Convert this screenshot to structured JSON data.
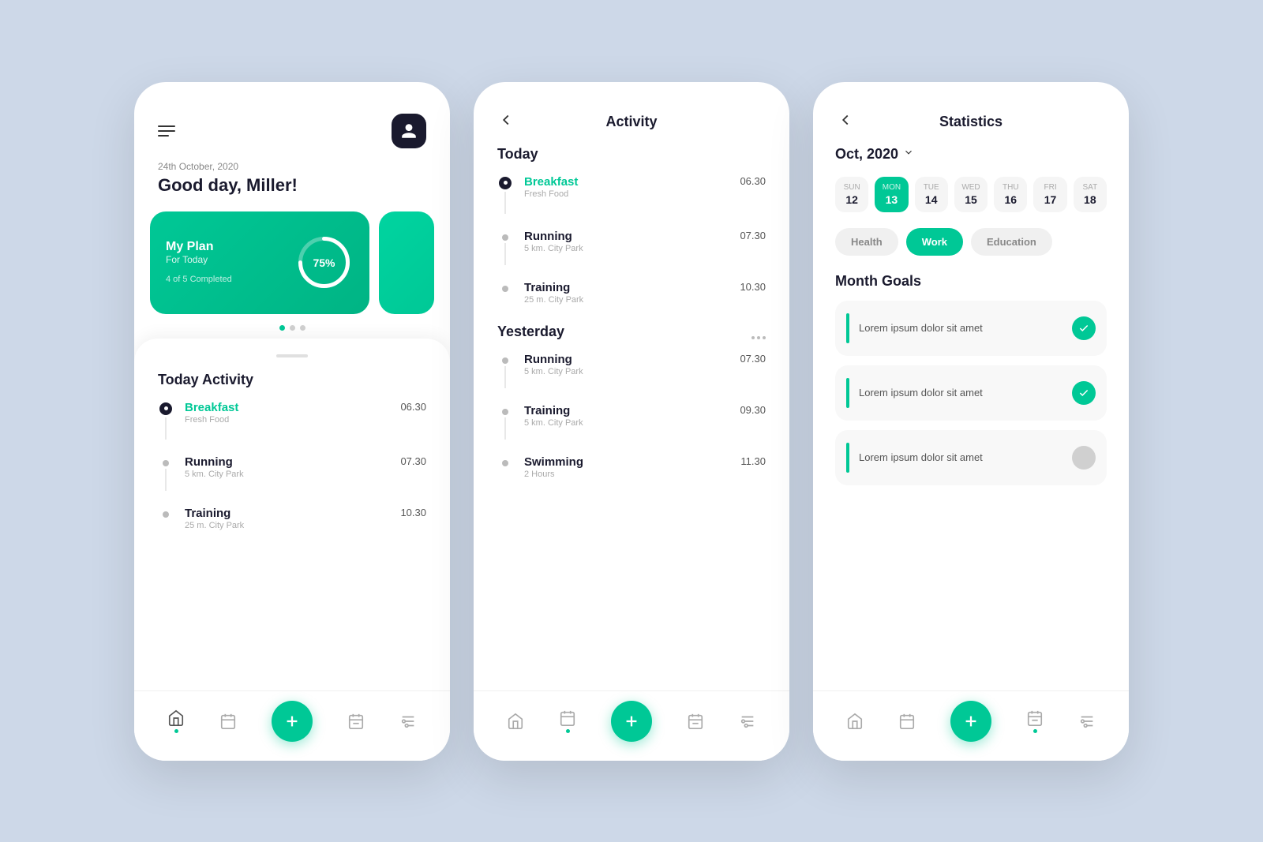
{
  "phone1": {
    "date": "24th October, 2020",
    "greeting": "Good day, Miller!",
    "plan": {
      "title": "My Plan",
      "subtitle": "For Today",
      "completed": "4 of 5 Completed",
      "progress": "75%"
    },
    "today_activity_title": "Today Activity",
    "activities": [
      {
        "name": "Breakfast",
        "sub": "Fresh Food",
        "time": "06.30",
        "done": true,
        "teal": true
      },
      {
        "name": "Running",
        "sub": "5 km. City Park",
        "time": "07.30",
        "done": false,
        "teal": false
      },
      {
        "name": "Training",
        "sub": "25 m. City Park",
        "time": "10.30",
        "done": false,
        "teal": false
      }
    ]
  },
  "phone2": {
    "back_label": "←",
    "title": "Activity",
    "today_label": "Today",
    "today_activities": [
      {
        "name": "Breakfast",
        "sub": "Fresh Food",
        "time": "06.30",
        "done": true,
        "teal": true
      },
      {
        "name": "Running",
        "sub": "5 km. City Park",
        "time": "07.30",
        "done": false,
        "teal": false
      },
      {
        "name": "Training",
        "sub": "25 m. City Park",
        "time": "10.30",
        "done": false,
        "teal": false
      }
    ],
    "yesterday_label": "Yesterday",
    "yesterday_activities": [
      {
        "name": "Running",
        "sub": "5 km. City Park",
        "time": "07.30",
        "done": false,
        "teal": false
      },
      {
        "name": "Training",
        "sub": "5 km. City Park",
        "time": "09.30",
        "done": false,
        "teal": false
      },
      {
        "name": "Swimming",
        "sub": "2 Hours",
        "time": "11.30",
        "done": false,
        "teal": false
      }
    ]
  },
  "phone3": {
    "back_label": "←",
    "title": "Statistics",
    "month": "Oct, 2020",
    "calendar": [
      {
        "day": "SUN",
        "num": "12",
        "active": false
      },
      {
        "day": "MON",
        "num": "13",
        "active": true
      },
      {
        "day": "TUE",
        "num": "14",
        "active": false
      },
      {
        "day": "WED",
        "num": "15",
        "active": false
      },
      {
        "day": "THU",
        "num": "16",
        "active": false
      },
      {
        "day": "FRI",
        "num": "17",
        "active": false
      },
      {
        "day": "SAT",
        "num": "18",
        "active": false
      }
    ],
    "filter_tabs": [
      {
        "label": "Health",
        "active": false
      },
      {
        "label": "Work",
        "active": true
      },
      {
        "label": "Education",
        "active": false
      }
    ],
    "goals_title": "Month Goals",
    "goals": [
      {
        "text": "Lorem ipsum dolor sit amet",
        "done": true
      },
      {
        "text": "Lorem ipsum dolor sit amet",
        "done": true
      },
      {
        "text": "Lorem ipsum dolor sit amet",
        "done": false
      }
    ]
  },
  "nav": {
    "add_label": "+"
  }
}
